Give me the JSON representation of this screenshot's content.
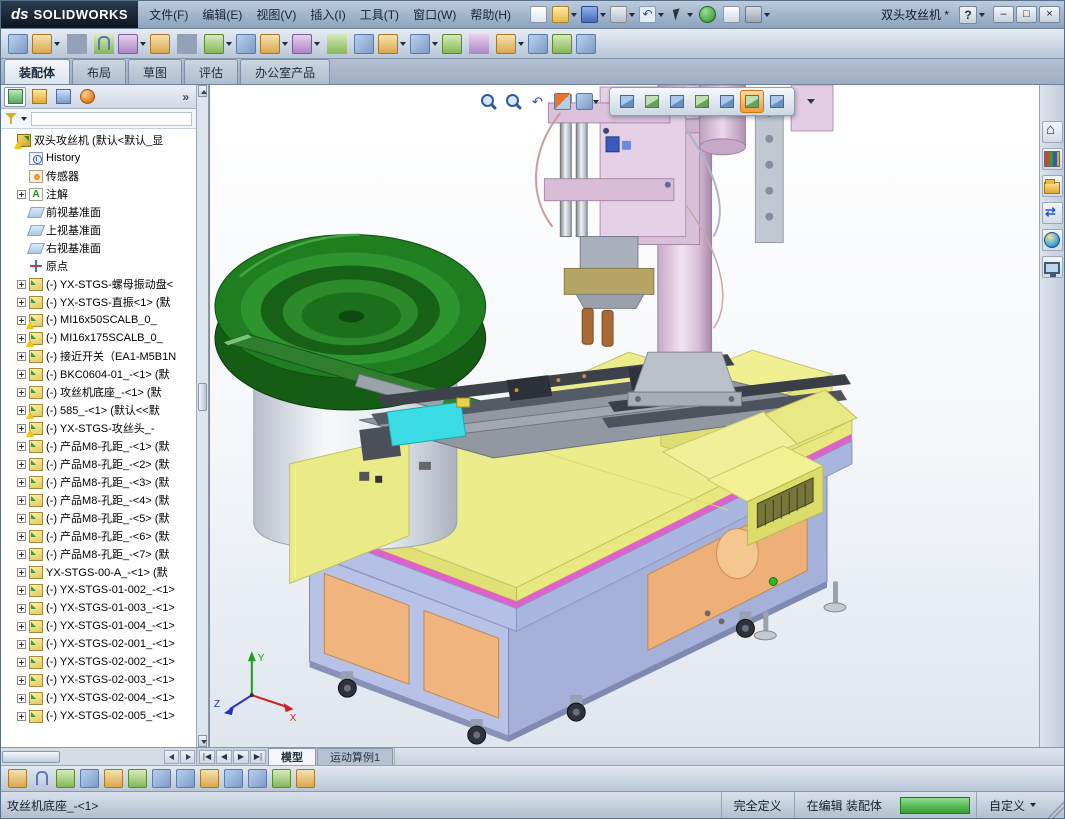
{
  "window": {
    "logo_ds": "ds",
    "logo_text": "SOLIDWORKS",
    "title": "双头攻丝机 *",
    "help": "?",
    "minimize": "–",
    "restore": "□",
    "close": "×"
  },
  "menubar": [
    "文件(F)",
    "编辑(E)",
    "视图(V)",
    "插入(I)",
    "工具(T)",
    "窗口(W)",
    "帮助(H)"
  ],
  "titlebar_tools": [
    {
      "name": "new-document-icon"
    },
    {
      "name": "open-icon",
      "caret": true
    },
    {
      "name": "save-icon",
      "caret": true
    },
    {
      "name": "print-icon",
      "caret": true
    },
    {
      "name": "undo-icon",
      "caret": true
    },
    {
      "name": "select-icon",
      "caret": true
    },
    {
      "name": "rebuild-icon"
    },
    {
      "name": "file-properties-icon"
    },
    {
      "name": "options-icon",
      "caret": true
    }
  ],
  "assembly_toolbar": [
    {
      "name": "edit-component-icon"
    },
    {
      "name": "insert-components-icon",
      "caret": true
    },
    {
      "name": "separator"
    },
    {
      "name": "mate-icon"
    },
    {
      "name": "linear-component-pattern-icon",
      "caret": true
    },
    {
      "name": "smart-fasteners-icon"
    },
    {
      "name": "separator"
    },
    {
      "name": "move-component-icon",
      "caret": true
    },
    {
      "name": "show-hidden-components-icon"
    },
    {
      "name": "assembly-features-icon",
      "caret": true
    },
    {
      "name": "reference-geometry-icon",
      "caret": true
    },
    {
      "name": "separator"
    },
    {
      "name": "new-motion-study-icon"
    },
    {
      "name": "bill-of-materials-icon",
      "caret": true
    },
    {
      "name": "exploded-view-icon",
      "caret": true
    },
    {
      "name": "explode-line-sketch-icon"
    },
    {
      "name": "separator"
    },
    {
      "name": "interference-detection-icon",
      "caret": true
    },
    {
      "name": "measure-icon"
    },
    {
      "name": "section-view-icon"
    },
    {
      "name": "instant3d-icon"
    }
  ],
  "command_tabs": [
    {
      "label": "装配体",
      "active": true
    },
    {
      "label": "布局"
    },
    {
      "label": "草图"
    },
    {
      "label": "评估"
    },
    {
      "label": "办公室产品"
    }
  ],
  "feature_panel": {
    "header_icons": [
      {
        "name": "featuremanager-tree-icon",
        "active": true
      },
      {
        "name": "propertymanager-icon"
      },
      {
        "name": "configurationmanager-icon"
      },
      {
        "name": "displaymanager-icon"
      }
    ],
    "overflow": "»",
    "tree": [
      {
        "label": "双头攻丝机 (默认<默认_显",
        "icon": "assembly",
        "warn": true,
        "ind": 0
      },
      {
        "label": "History",
        "icon": "history",
        "ind": 1
      },
      {
        "label": "传感器",
        "icon": "sensor",
        "ind": 1
      },
      {
        "label": "注解",
        "icon": "annotation",
        "expand": "+",
        "ind": 1
      },
      {
        "label": "前视基准面",
        "icon": "plane",
        "ind": 1
      },
      {
        "label": "上视基准面",
        "icon": "plane",
        "ind": 1
      },
      {
        "label": "右视基准面",
        "icon": "plane",
        "ind": 1
      },
      {
        "label": "原点",
        "icon": "origin",
        "ind": 1
      },
      {
        "label": "(-) YX-STGS-螺母振动盘<",
        "icon": "component",
        "expand": "+",
        "ind": 1
      },
      {
        "label": "(-) YX-STGS-直振<1> (默",
        "icon": "component",
        "expand": "+",
        "ind": 1
      },
      {
        "label": "(-) MI16x50SCALB_0_",
        "icon": "component",
        "warn": true,
        "expand": "+",
        "ind": 1
      },
      {
        "label": "(-) MI16x175SCALB_0_",
        "icon": "component",
        "warn": true,
        "expand": "+",
        "ind": 1
      },
      {
        "label": "(-) 接近开关（EA1-M5B1N",
        "icon": "component",
        "expand": "+",
        "ind": 1
      },
      {
        "label": "(-) BKC0604-01_-<1> (默",
        "icon": "component",
        "expand": "+",
        "ind": 1
      },
      {
        "label": "(-) 攻丝机底座_-<1> (默",
        "icon": "component",
        "expand": "+",
        "ind": 1
      },
      {
        "label": "(-) 585_-<1> (默认<<默",
        "icon": "component",
        "warn": true,
        "expand": "+",
        "ind": 1
      },
      {
        "label": "(-) YX-STGS-攻丝头_-",
        "icon": "component",
        "warn": true,
        "expand": "+",
        "ind": 1
      },
      {
        "label": "(-) 产品M8-孔距_-<1> (默",
        "icon": "component",
        "expand": "+",
        "ind": 1
      },
      {
        "label": "(-) 产品M8-孔距_-<2> (默",
        "icon": "component",
        "expand": "+",
        "ind": 1
      },
      {
        "label": "(-) 产品M8-孔距_-<3> (默",
        "icon": "component",
        "expand": "+",
        "ind": 1
      },
      {
        "label": "(-) 产品M8-孔距_-<4> (默",
        "icon": "component",
        "expand": "+",
        "ind": 1
      },
      {
        "label": "(-) 产品M8-孔距_-<5> (默",
        "icon": "component",
        "expand": "+",
        "ind": 1
      },
      {
        "label": "(-) 产品M8-孔距_-<6> (默",
        "icon": "component",
        "expand": "+",
        "ind": 1
      },
      {
        "label": "(-) 产品M8-孔距_-<7> (默",
        "icon": "component",
        "expand": "+",
        "ind": 1
      },
      {
        "label": "YX-STGS-00-A_-<1> (默",
        "icon": "component",
        "expand": "+",
        "ind": 1
      },
      {
        "label": "(-) YX-STGS-01-002_-<1>",
        "icon": "component",
        "expand": "+",
        "ind": 1
      },
      {
        "label": "(-) YX-STGS-01-003_-<1>",
        "icon": "component",
        "expand": "+",
        "ind": 1
      },
      {
        "label": "(-) YX-STGS-01-004_-<1>",
        "icon": "component",
        "expand": "+",
        "ind": 1
      },
      {
        "label": "(-) YX-STGS-02-001_-<1>",
        "icon": "component",
        "expand": "+",
        "ind": 1
      },
      {
        "label": "(-) YX-STGS-02-002_-<1>",
        "icon": "component",
        "expand": "+",
        "ind": 1
      },
      {
        "label": "(-) YX-STGS-02-003_-<1>",
        "icon": "component",
        "expand": "+",
        "ind": 1
      },
      {
        "label": "(-) YX-STGS-02-004_-<1>",
        "icon": "component",
        "expand": "+",
        "ind": 1
      },
      {
        "label": "(-) YX-STGS-02-005_-<1>",
        "icon": "component",
        "expand": "+",
        "ind": 1
      }
    ]
  },
  "viewport": {
    "headsup_group1": [
      {
        "name": "zoom-fit-icon"
      },
      {
        "name": "zoom-area-icon"
      },
      {
        "name": "previous-view-icon"
      },
      {
        "name": "section-view-icon"
      },
      {
        "name": "view-orientation-icon",
        "caret": true
      }
    ],
    "headsup_group2": [
      {
        "name": "display-style-icon",
        "caret": true
      },
      {
        "name": "hide-show-items-icon",
        "caret": true
      },
      {
        "name": "edit-appearance-icon"
      },
      {
        "name": "apply-scene-icon",
        "caret": true
      },
      {
        "name": "view-settings-icon",
        "caret": true
      },
      {
        "name": "rotate-view-icon",
        "active": true
      },
      {
        "name": "camera-icon"
      }
    ],
    "triad": {
      "x": "X",
      "y": "Y",
      "z": "Z"
    }
  },
  "task_pane": [
    {
      "name": "home-icon"
    },
    {
      "name": "design-library-icon"
    },
    {
      "name": "file-explorer-icon"
    },
    {
      "name": "view-palette-icon"
    },
    {
      "name": "appearances-icon"
    },
    {
      "name": "custom-properties-icon"
    }
  ],
  "bottom": {
    "nav_buttons": [
      "|◀",
      "◀",
      "▶",
      "▶|"
    ],
    "tabs": [
      {
        "label": "模型",
        "active": true
      },
      {
        "label": "运动算例1"
      }
    ],
    "toolbar": [
      {
        "name": "insert-components-icon"
      },
      {
        "name": "mate-icon"
      },
      {
        "name": "hide-show-components-icon"
      },
      {
        "name": "edit-component-icon"
      },
      {
        "name": "no-external-references-icon"
      },
      {
        "name": "change-transparency-icon"
      },
      {
        "name": "isolate-icon"
      },
      {
        "name": "linear-component-pattern-icon"
      },
      {
        "name": "smart-fasteners-icon"
      },
      {
        "name": "move-component-icon"
      },
      {
        "name": "exploded-view-icon"
      },
      {
        "name": "interference-detection-icon"
      },
      {
        "name": "large-assembly-mode-icon"
      }
    ]
  },
  "statusbar": {
    "selection": "攻丝机底座_-<1>",
    "defined": "完全定义",
    "editing": "在编辑 装配体",
    "custom": "自定义"
  }
}
